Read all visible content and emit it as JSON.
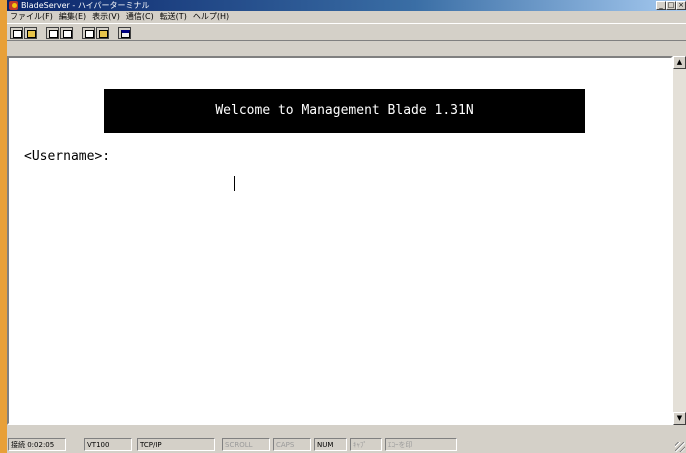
{
  "window": {
    "title": "BladeServer - ハイパーターミナル",
    "controls": {
      "minimize": "_",
      "maximize": "□",
      "close": "×"
    }
  },
  "menubar": {
    "items": [
      {
        "label": "ファイル(F)"
      },
      {
        "label": "編集(E)"
      },
      {
        "label": "表示(V)"
      },
      {
        "label": "通信(C)"
      },
      {
        "label": "転送(T)"
      },
      {
        "label": "ヘルプ(H)"
      }
    ]
  },
  "toolbar": {
    "buttons": [
      {
        "icon": "new-file-icon"
      },
      {
        "icon": "open-folder-icon"
      },
      {
        "icon": "connect-phone-icon"
      },
      {
        "icon": "disconnect-icon"
      },
      {
        "icon": "send-file-icon"
      },
      {
        "icon": "receive-file-icon"
      },
      {
        "icon": "properties-icon"
      }
    ]
  },
  "terminal": {
    "banner": "Welcome to Management Blade 1.31N",
    "prompt": "<Username>:"
  },
  "scrollbar": {
    "up": "▲",
    "down": "▼"
  },
  "statusbar": {
    "connected_time": "接続 0:02:05",
    "emulation": "VT100",
    "connection": "TCP/IP",
    "scroll": "SCROLL",
    "caps": "CAPS",
    "num": "NUM",
    "capture": "ｷｬﾌﾟ",
    "echo": "ｴｺｰを印"
  },
  "colors": {
    "desktop": "#e8a038",
    "title_active": "#0a246a",
    "chrome": "#d4d0c8",
    "terminal_bg": "#ffffff",
    "banner_bg": "#000000"
  }
}
